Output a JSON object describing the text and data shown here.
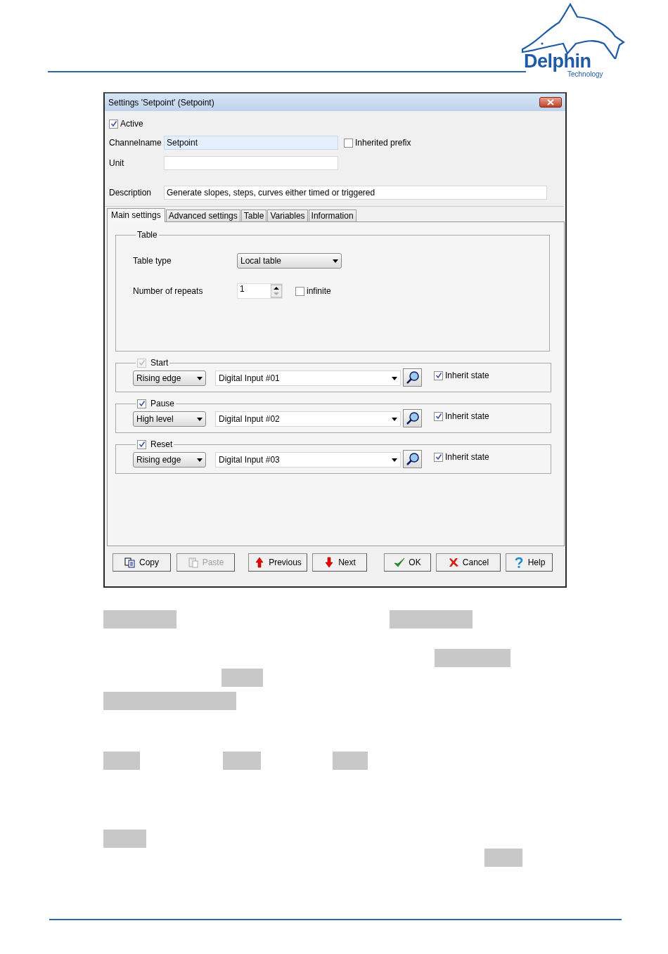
{
  "logo": {
    "name": "Delphin",
    "tagline": "Technology"
  },
  "dialog": {
    "title": "Settings 'Setpoint' (Setpoint)",
    "active": {
      "label": "Active",
      "checked": true
    },
    "channelname": {
      "label": "Channelname",
      "value": "Setpoint",
      "focused": true
    },
    "inherited_prefix": {
      "label": "Inherited prefix",
      "checked": false
    },
    "unit": {
      "label": "Unit"
    },
    "description": {
      "label": "Description",
      "value": "Generate slopes, steps, curves either timed or triggered"
    },
    "tabs": [
      {
        "label": "Main settings",
        "selected": true
      },
      {
        "label": "Advanced settings",
        "selected": false
      },
      {
        "label": "Table",
        "selected": false
      },
      {
        "label": "Variables",
        "selected": false
      },
      {
        "label": "Information",
        "selected": false
      }
    ],
    "table_group": {
      "title": "Table",
      "table_type": {
        "label": "Table type",
        "value": "Local table"
      },
      "repeats": {
        "label": "Number of repeats",
        "value": "1"
      },
      "infinite": {
        "label": "infinite",
        "checked": false
      }
    },
    "triggers": [
      {
        "label": "Start",
        "checked": true,
        "disabled": true,
        "mode": "Rising edge",
        "input": "Digital Input #01",
        "inherit": {
          "label": "Inherit state",
          "checked": true
        }
      },
      {
        "label": "Pause",
        "checked": true,
        "disabled": false,
        "mode": "High level",
        "input": "Digital Input #02",
        "inherit": {
          "label": "Inherit state",
          "checked": true
        }
      },
      {
        "label": "Reset",
        "checked": true,
        "disabled": false,
        "mode": "Rising edge",
        "input": "Digital Input #03",
        "inherit": {
          "label": "Inherit state",
          "checked": true
        }
      }
    ],
    "buttons": [
      {
        "label": "Copy",
        "kind": "copy",
        "disabled": false
      },
      {
        "label": "Paste",
        "kind": "paste",
        "disabled": true
      },
      {
        "label": "Previous",
        "kind": "up",
        "disabled": false
      },
      {
        "label": "Next",
        "kind": "down",
        "disabled": false
      },
      {
        "label": "OK",
        "kind": "ok",
        "disabled": false
      },
      {
        "label": "Cancel",
        "kind": "cancel",
        "disabled": false
      },
      {
        "label": "Help",
        "kind": "help",
        "disabled": false
      }
    ]
  }
}
